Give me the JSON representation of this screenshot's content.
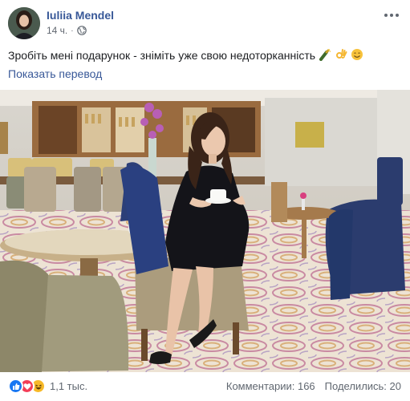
{
  "post": {
    "author": "Iuliia Mendel",
    "time": "14 ч.",
    "separator": "·",
    "privacy_icon": "globe-icon",
    "text": "Зробіть мені подарунок - зніміть уже свою недоторканність",
    "text_emojis": [
      "champagne-emoji",
      "ok-hand-emoji",
      "smile-emoji"
    ],
    "translate_link": "Показать перевод"
  },
  "footer": {
    "reactions": [
      "like-icon",
      "love-icon",
      "haha-icon"
    ],
    "reactions_count": "1,1 тыс.",
    "comments": "Комментарии: 166",
    "shares": "Поделились: 20"
  },
  "colors": {
    "link": "#385898",
    "text": "#1c1e21",
    "meta": "#616770",
    "like": "#1877f2",
    "love": "#f33e58",
    "haha": "#f7b928"
  }
}
